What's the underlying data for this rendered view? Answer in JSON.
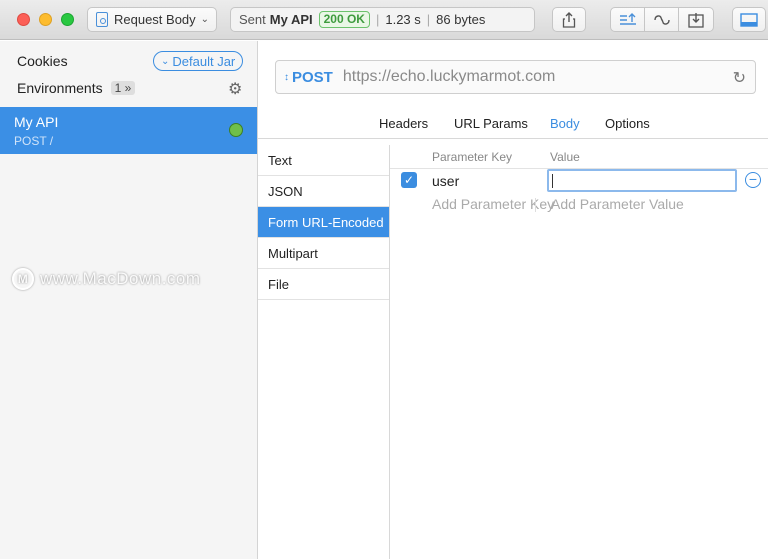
{
  "toolbar": {
    "document_name": "Request Body",
    "status": {
      "sent_label": "Sent",
      "api_name": "My API",
      "code": "200 OK",
      "time": "1.23 s",
      "size": "86 bytes",
      "code_color": "#3e9b3e"
    },
    "icons": [
      "share-icon",
      "upload-sort-icon",
      "link-icon",
      "import-icon",
      "panel-icon"
    ]
  },
  "sidebar": {
    "cookies_label": "Cookies",
    "jar_label": "Default Jar",
    "environments_label": "Environments",
    "environments_count": "1",
    "request": {
      "name": "My API",
      "meta": "POST /",
      "status_color": "#6fbf4a"
    }
  },
  "watermark": "www.MacDown.com",
  "main": {
    "method": "POST",
    "url": "https://echo.luckymarmot.com",
    "tabs": [
      {
        "label": "Headers"
      },
      {
        "label": "URL Params"
      },
      {
        "label": "Body"
      },
      {
        "label": "Options"
      }
    ],
    "active_tab": "Body",
    "body_types": [
      "Text",
      "JSON",
      "Form URL-Encoded",
      "Multipart",
      "File"
    ],
    "active_body_type": "Form URL-Encoded",
    "form": {
      "key_header": "Parameter Key",
      "value_header": "Value",
      "rows": [
        {
          "key": "user",
          "value": "",
          "enabled": true
        }
      ],
      "add_key_placeholder": "Add Parameter Key",
      "add_value_placeholder": "Add Parameter Value"
    }
  },
  "accent_color": "#3b8de0"
}
